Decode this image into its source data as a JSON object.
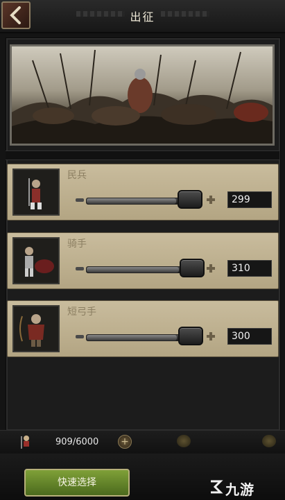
{
  "header": {
    "title": "出征"
  },
  "units": [
    {
      "name": "民兵",
      "count": "299",
      "level": 0.83
    },
    {
      "name": "骑手",
      "count": "310",
      "level": 0.86
    },
    {
      "name": "短弓手",
      "count": "300",
      "level": 0.84
    }
  ],
  "footer": {
    "troops": "909/6000",
    "quick_select": "快速选择"
  },
  "watermark": {
    "text": "九游"
  },
  "colors": {
    "panel": "#c9bc9d",
    "accent_green": "#7fa038",
    "back_button": "#5a3528"
  }
}
